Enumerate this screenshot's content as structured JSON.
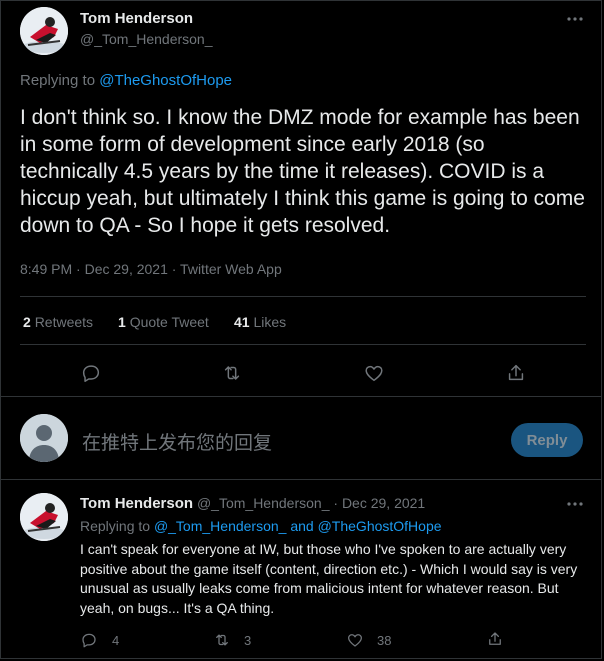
{
  "tweet": {
    "author_name": "Tom Henderson",
    "author_handle": "@_Tom_Henderson_",
    "replying_prefix": "Replying to",
    "replying_to": "@TheGhostOfHope",
    "text": "I don't think so. I know the DMZ mode for example has been in some form of development since early 2018 (so technically 4.5 years by the time it releases). COVID is a hiccup yeah, but ultimately I think this game is going to come down to QA - So I hope it gets resolved.",
    "meta": "8:49 PM · Dec 29, 2021 · Twitter Web App",
    "stats": {
      "retweets_count": "2",
      "retweets_label": "Retweets",
      "quotes_count": "1",
      "quotes_label": "Quote Tweet",
      "likes_count": "41",
      "likes_label": "Likes"
    }
  },
  "composer": {
    "placeholder": "在推特上发布您的回复",
    "reply_label": "Reply"
  },
  "reply": {
    "author_name": "Tom Henderson",
    "author_handle": "@_Tom_Henderson_",
    "separator": "·",
    "date": "Dec 29, 2021",
    "replying_prefix": "Replying to",
    "replying_to_1": "@_Tom_Henderson_",
    "replying_and": "and",
    "replying_to_2": "@TheGhostOfHope",
    "text": "I can't speak for everyone at IW, but those who I've spoken to are actually very positive about the game itself (content, direction etc.) - Which I would say is very unusual as usually leaks come from malicious intent for whatever reason. But yeah, on bugs... It's a QA thing.",
    "replies_count": "4",
    "retweets_count": "3",
    "likes_count": "38"
  },
  "colors": {
    "background": "#000000",
    "text": "#e7e9ea",
    "muted": "#71767b",
    "accent": "#1d9bf0",
    "border": "#2f3336",
    "reply_button_bg": "#1a5580"
  },
  "icons": [
    "more-icon",
    "reply-icon",
    "retweet-icon",
    "like-icon",
    "share-icon",
    "default-avatar-icon"
  ]
}
